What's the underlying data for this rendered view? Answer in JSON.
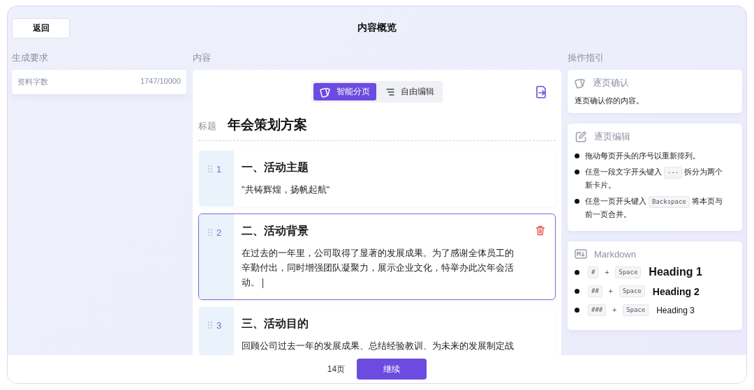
{
  "header": {
    "back_button": "返回",
    "title": "内容概览"
  },
  "left": {
    "label": "生成要求",
    "stat": {
      "name": "资料字数",
      "value": "1747/10000"
    }
  },
  "content": {
    "label": "内容",
    "modes": [
      {
        "label": "智能分页",
        "selected": true,
        "kind": "cards"
      },
      {
        "label": "自由编辑",
        "selected": false,
        "kind": "list"
      }
    ],
    "title_label": "标题",
    "title": "年会策划方案",
    "pages": [
      {
        "number": "1",
        "heading": "一、活动主题",
        "body": "\"共铸辉煌，扬帆起航\"",
        "selected": false
      },
      {
        "number": "2",
        "heading": "二、活动背景",
        "body": "在过去的一年里，公司取得了显著的发展成果。为了感谢全体员工的辛勤付出，同时增强团队凝聚力，展示企业文化，特举办此次年会活动。",
        "selected": true
      },
      {
        "number": "3",
        "heading": "三、活动目的",
        "body": "回顾公司过去一年的发展成果、总结经验教训、为未来的发展制定战",
        "selected": false
      }
    ]
  },
  "guide": {
    "label": "操作指引",
    "cards": [
      {
        "kind": "text",
        "title": "逐页确认",
        "text": "逐页确认你的内容。"
      },
      {
        "kind": "list",
        "title": "逐页编辑",
        "items": [
          [
            {
              "text": "拖动每页开头的序号以重新排列。"
            }
          ],
          [
            {
              "text": "任意一段文字开头键入"
            },
            {
              "key": "---"
            },
            {
              "text": "拆分为两个"
            },
            {
              "text": "新卡片。"
            }
          ],
          [
            {
              "text": "任意一页开头键入"
            },
            {
              "key": "Backspace"
            },
            {
              "text": "将本页与"
            },
            {
              "text": "前一页合并。"
            }
          ]
        ]
      },
      {
        "kind": "markdown",
        "title": "Markdown",
        "rows": [
          {
            "kind": "h1",
            "mark": "#",
            "plus": "+",
            "key": "Space",
            "heading": "Heading 1"
          },
          {
            "kind": "h2",
            "mark": "##",
            "plus": "+",
            "key": "Space",
            "heading": "Heading 2"
          },
          {
            "kind": "h3",
            "mark": "###",
            "plus": "+",
            "key": "Space",
            "heading": "Heading 3"
          }
        ]
      }
    ]
  },
  "footer": {
    "page_count": "14页",
    "continue_button": "继续"
  }
}
